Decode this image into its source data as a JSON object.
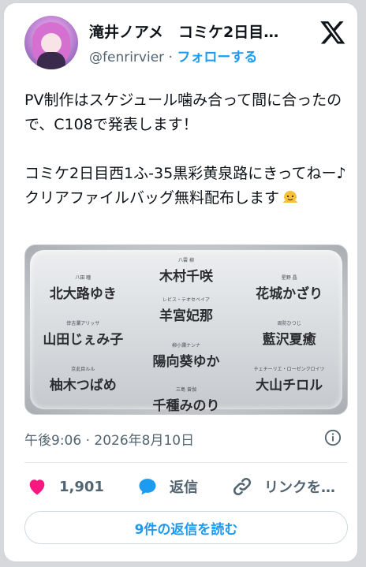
{
  "author": {
    "display_name": "滝井ノアメ　コミケ2日目…",
    "handle": "@fenrirvier",
    "separator": " · ",
    "follow_label": "フォローする",
    "avatar_icon": "avatar-icon"
  },
  "brand": {
    "icon": "x-logo-icon"
  },
  "tweet": {
    "text": "PV制作はスケジュール噛み合って間に合ったので、C108で発表します！\n\nコミケ2日目西1ふ-35黒彩黄泉路にきってねー♪\nクリアファイルバッグ無料配布します",
    "emoji": "melting-face-emoji"
  },
  "media": {
    "cast": [
      {
        "role": "八雲 柳",
        "actor": "木村千咲"
      },
      {
        "role": "八田 瞳",
        "actor": "北大路ゆき"
      },
      {
        "role": "星野 晶",
        "actor": "花城かざり"
      },
      {
        "role": "レビス・テオセベイア",
        "actor": "羊宮妃那"
      },
      {
        "role": "倖吉瀾アリッサ",
        "actor": "山田じぇみ子"
      },
      {
        "role": "周防ひつじ",
        "actor": "藍沢夏癒"
      },
      {
        "role": "柳小瀾ナンナ",
        "actor": "陽向葵ゆか"
      },
      {
        "role": "京此目ルル",
        "actor": "柚木つばめ"
      },
      {
        "role": "チェチーリエ・ローゼンクロイツ",
        "actor": "大山チロル"
      },
      {
        "role": "三島 曾伽",
        "actor": "千種みのり"
      }
    ]
  },
  "meta": {
    "time": "午後9:06",
    "separator": " · ",
    "date": "2026年8月10日",
    "info_icon": "info-icon"
  },
  "actions": {
    "likes_count": "1,901",
    "reply_label": "返信",
    "link_label": "リンクを…"
  },
  "replies_button": {
    "label": "9件の返信を読む"
  },
  "colors": {
    "accent": "#1d9bf0",
    "like": "#f91880",
    "secondary_text": "#536471",
    "primary_text": "#0f1419"
  }
}
